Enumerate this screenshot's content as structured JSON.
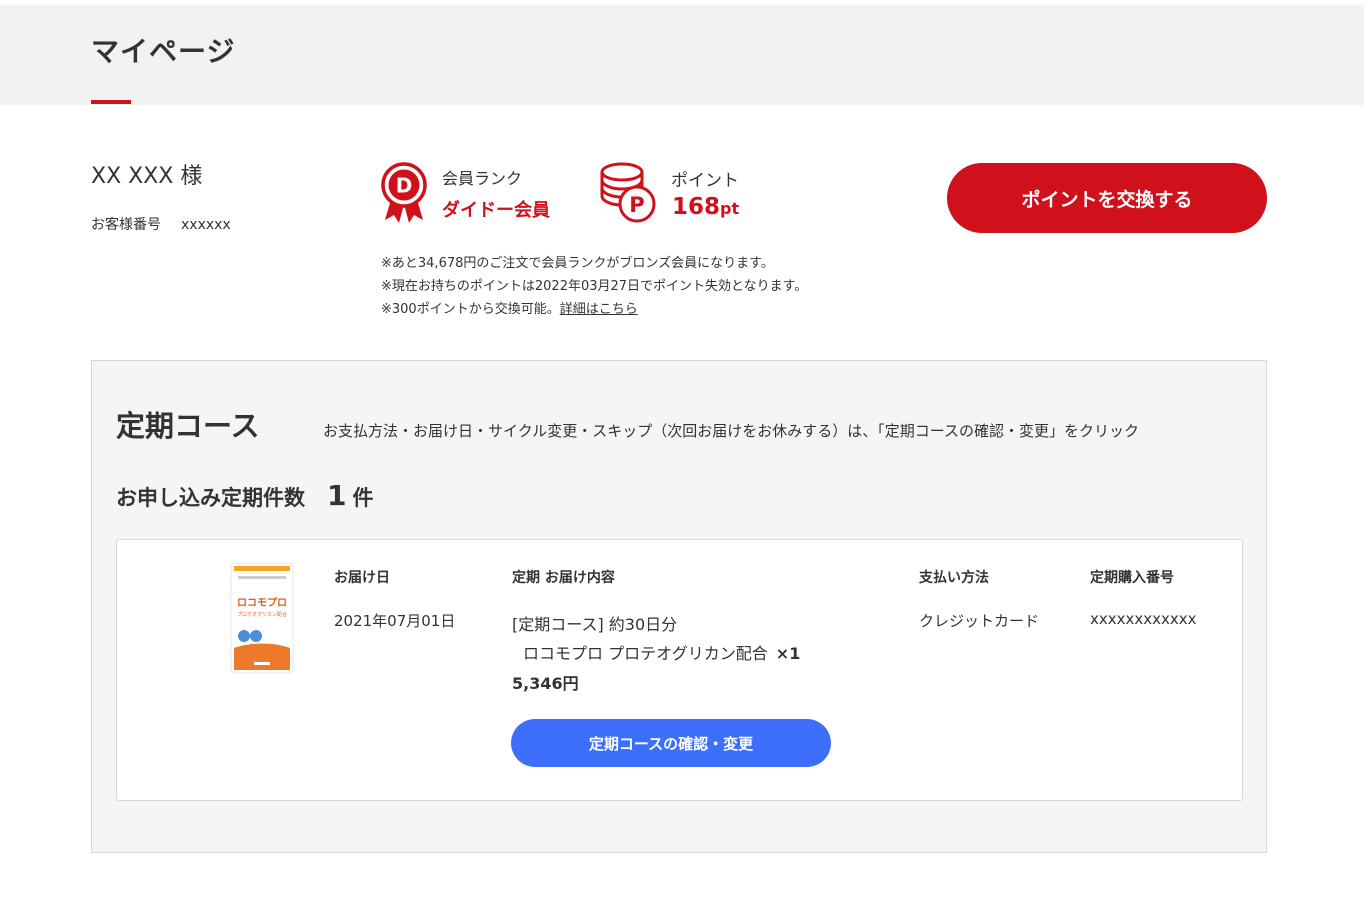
{
  "header": {
    "title": "マイページ"
  },
  "customer": {
    "name": "XX XXX 様",
    "number_label": "お客様番号",
    "number_value": "xxxxxx"
  },
  "rank": {
    "icon": "ribbon-badge-icon",
    "icon_letter": "D",
    "label": "会員ランク",
    "value": "ダイドー会員"
  },
  "points": {
    "icon": "coin-stack-icon",
    "icon_letter": "P",
    "label": "ポイント",
    "value": "168",
    "unit": "pt"
  },
  "exchange_button": {
    "label": "ポイントを交換する"
  },
  "notes": {
    "line1": "※あと34,678円のご注文で会員ランクがブロンズ会員になります。",
    "line2": "※現在お持ちのポイントは2022年03月27日でポイント失効となります。",
    "line3_prefix": "※300ポイントから交換可能。",
    "line3_link": "詳細はこちら"
  },
  "course": {
    "title": "定期コース",
    "description": "お支払方法・お届け日・サイクル変更・スキップ（次回お届けをお休みする）は、「定期コースの確認・変更」をクリック",
    "count_label": "お申し込み定期件数",
    "count_value": "1",
    "count_unit": "件"
  },
  "order": {
    "product_image_label": "ロコモプロ",
    "product_image_sub": "プロテオグリカン配合",
    "headers": {
      "delivery_date": "お届け日",
      "content": "定期 お届け内容",
      "payment": "支払い方法",
      "purchase_number": "定期購入番号"
    },
    "delivery_date": "2021年07月01日",
    "content_line1": "[定期コース] 約30日分",
    "content_product": "ロコモプロ プロテオグリカン配合",
    "content_qty": "×1",
    "content_price": "5,346円",
    "payment": "クレジットカード",
    "purchase_number": "xxxxxxxxxxxx",
    "confirm_button": "定期コースの確認・変更"
  },
  "colors": {
    "brand_red": "#d0111b",
    "button_blue": "#3d6ffa",
    "header_bg": "#f2f2f2",
    "panel_bg": "#f5f5f5"
  }
}
